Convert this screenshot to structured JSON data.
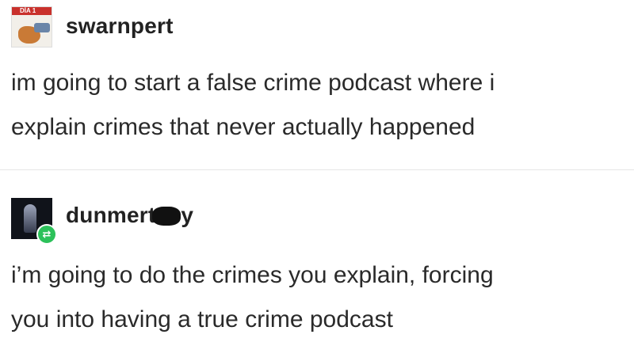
{
  "posts": [
    {
      "username": "swarnpert",
      "text_lines": [
        "im going to start a false crime podcast where i",
        "explain crimes that never actually happened"
      ],
      "avatar_text": "DÍA 1"
    },
    {
      "username_visible": "dunmert",
      "username_tail": "y",
      "text_lines": [
        "i’m going to do the crimes you explain, forcing",
        "you into having a true crime podcast"
      ],
      "badge_icon": "reblog-icon"
    }
  ],
  "colors": {
    "badge": "#2cc15a",
    "text": "#222222"
  }
}
